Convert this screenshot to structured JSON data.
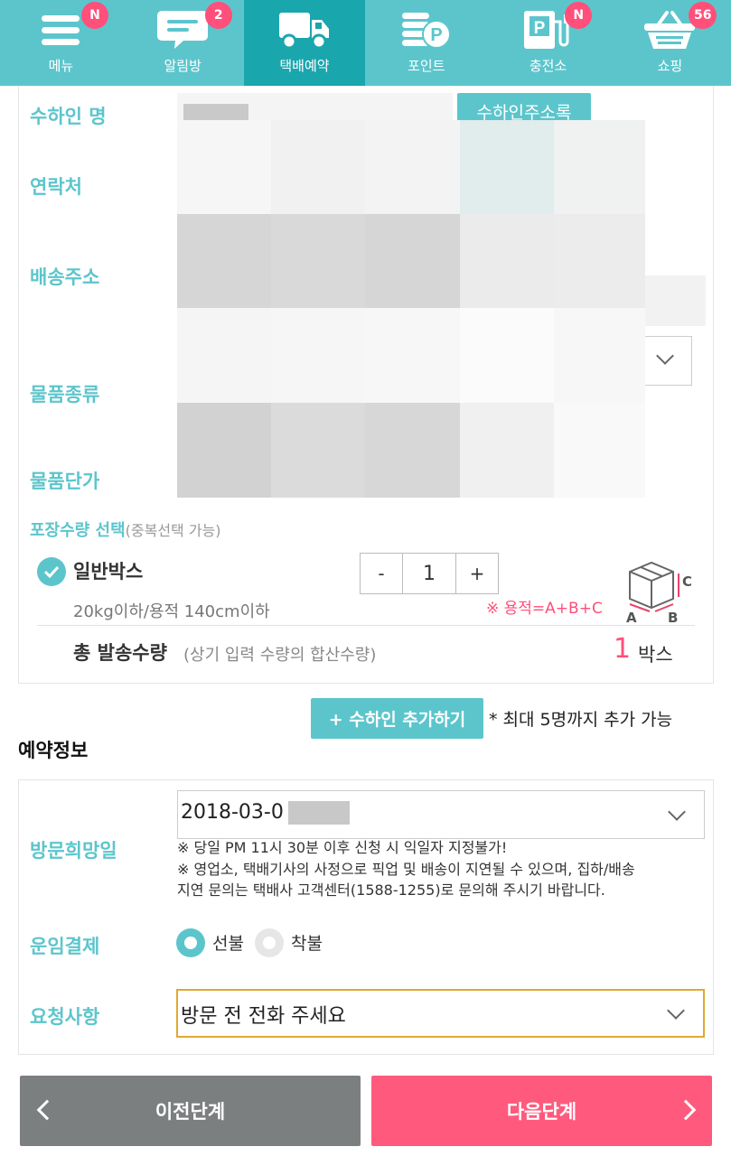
{
  "nav": [
    {
      "label": "메뉴",
      "icon": "menu-icon",
      "badge": "N",
      "active": false
    },
    {
      "label": "알림방",
      "icon": "chat-icon",
      "badge": "2",
      "active": false
    },
    {
      "label": "택배예약",
      "icon": "truck-icon",
      "badge": "",
      "active": true
    },
    {
      "label": "포인트",
      "icon": "points-icon",
      "badge": "",
      "active": false
    },
    {
      "label": "충전소",
      "icon": "charging-station-icon",
      "badge": "N",
      "active": false
    },
    {
      "label": "쇼핑",
      "icon": "basket-icon",
      "badge": "56",
      "active": false
    }
  ],
  "recipient": {
    "name_label": "수하인 명",
    "address_book_button": "수하인주소록",
    "contact_label": "연락처",
    "address_label": "배송주소",
    "item_type_label": "물품종류",
    "item_price_label": "물품단가"
  },
  "packaging": {
    "title": "포장수량 선택",
    "title_note": "(중복선택 가능)",
    "box_name": "일반박스",
    "box_desc": "20kg이하/용적 140cm이하",
    "minus": "-",
    "quantity": "1",
    "plus": "+",
    "volume_note": "※ 용적=A+B+C",
    "dim_a": "A",
    "dim_b": "B",
    "dim_c": "C",
    "total_label": "총 발송수량",
    "total_note": "(상기 입력 수량의 합산수량)",
    "total_value": "1",
    "total_unit": "박스"
  },
  "add_recipient": {
    "button": "+ 수하인 추가하기",
    "note": "* 최대 5명까지 추가 가능"
  },
  "reservation": {
    "title": "예약정보",
    "visit_date_label": "방문희망일",
    "visit_date_value": "2018-03-0",
    "note1": "※ 당일 PM 11시 30분 이후 신청 시 익일자 지정불가!",
    "note2": "※ 영업소, 택배기사의 사정으로 픽업 및 배송이 지연될 수 있으며, 집하/배송",
    "note3": "지연 문의는 택배사 고객센터(1588-1255)로 문의해 주시기 바랍니다.",
    "payment_label": "운임결제",
    "prepaid": "선불",
    "cod": "착불",
    "request_label": "요청사항",
    "request_value": "방문 전 전화 주세요"
  },
  "buttons": {
    "prev": "이전단계",
    "next": "다음단계"
  },
  "colors": {
    "teal": "#5cc5cc",
    "teal_active": "#1aa6ad",
    "pink": "#ff4f7a",
    "gray_button": "#7b7f80"
  }
}
